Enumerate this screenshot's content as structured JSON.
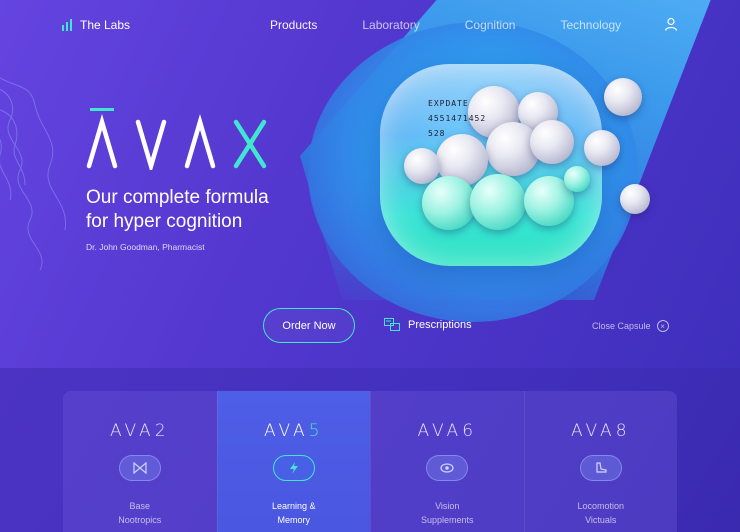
{
  "nav": {
    "brand": "The Labs",
    "links": [
      "Products",
      "Laboratory",
      "Cognition",
      "Technology"
    ]
  },
  "hero": {
    "logo_text": "AVAX",
    "headline_line1": "Our complete formula",
    "headline_line2": "for hyper cognition",
    "author": "Dr. John Goodman, Pharmacist",
    "capsule_label": [
      "EXPDATE",
      "4551471452",
      "528"
    ],
    "order_button": "Order Now",
    "prescriptions": "Prescriptions",
    "close_capsule": "Close Capsule"
  },
  "products": [
    {
      "prefix": "AVA",
      "num": "2",
      "desc1": "Base",
      "desc2": "Nootropics",
      "icon": "bowtie-icon"
    },
    {
      "prefix": "AVA",
      "num": "5",
      "desc1": "Learning &",
      "desc2": "Memory",
      "icon": "lightning-icon",
      "active": true
    },
    {
      "prefix": "AVA",
      "num": "6",
      "desc1": "Vision",
      "desc2": "Supplements",
      "icon": "eye-icon"
    },
    {
      "prefix": "AVA",
      "num": "8",
      "desc1": "Locomotion",
      "desc2": "Victuals",
      "icon": "boot-icon"
    }
  ],
  "colors": {
    "accent": "#41e6d0",
    "background": "#5338cf",
    "active_card": "#4f5ee6"
  }
}
